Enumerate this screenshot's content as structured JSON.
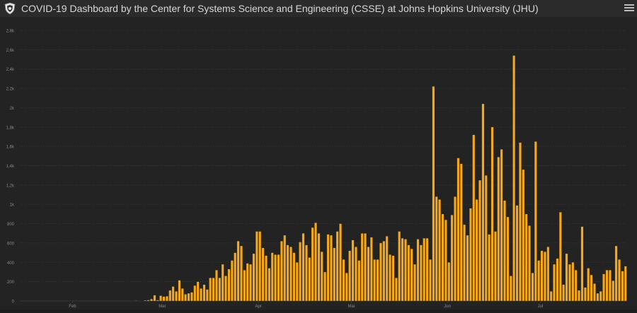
{
  "header": {
    "title": "COVID-19 Dashboard by the Center for Systems Science and Engineering (CSSE) at Johns Hopkins University (JHU)",
    "logo_icon": "shield-logo-icon",
    "menu_icon": "hamburger-menu-icon"
  },
  "colors": {
    "bar": "#f5a81c",
    "bar_stroke": "#2a2000",
    "grid": "#3a3a3a",
    "axis_text": "#8a8a8a",
    "background": "#232323"
  },
  "chart_data": {
    "type": "bar",
    "title": "",
    "xlabel": "",
    "ylabel": "",
    "ylim": [
      0,
      2800
    ],
    "yticks": [
      {
        "value": 0,
        "label": "0"
      },
      {
        "value": 200,
        "label": "200"
      },
      {
        "value": 400,
        "label": "400"
      },
      {
        "value": 600,
        "label": "600"
      },
      {
        "value": 800,
        "label": "800"
      },
      {
        "value": 1000,
        "label": "1k"
      },
      {
        "value": 1200,
        "label": "1,2k"
      },
      {
        "value": 1400,
        "label": "1,4k"
      },
      {
        "value": 1600,
        "label": "1,6k"
      },
      {
        "value": 1800,
        "label": "1,8k"
      },
      {
        "value": 2000,
        "label": "2k"
      },
      {
        "value": 2200,
        "label": "2,2k"
      },
      {
        "value": 2400,
        "label": "2,4k"
      },
      {
        "value": 2600,
        "label": "2,6k"
      },
      {
        "value": 2800,
        "label": "2,8k"
      }
    ],
    "xticks": [
      {
        "index": 17,
        "label": "Feb"
      },
      {
        "index": 46,
        "label": "Mar"
      },
      {
        "index": 77,
        "label": "Apr"
      },
      {
        "index": 107,
        "label": "Mai"
      },
      {
        "index": 138,
        "label": "Jun"
      },
      {
        "index": 168,
        "label": "Jul"
      }
    ],
    "values": [
      0,
      0,
      0,
      0,
      0,
      0,
      0,
      0,
      0,
      0,
      0,
      0,
      0,
      0,
      0,
      0,
      0,
      0,
      0,
      0,
      0,
      0,
      0,
      0,
      0,
      0,
      0,
      0,
      0,
      0,
      0,
      0,
      0,
      0,
      0,
      0,
      3,
      4,
      3,
      2,
      7,
      10,
      20,
      60,
      10,
      55,
      45,
      50,
      110,
      150,
      100,
      215,
      130,
      70,
      80,
      90,
      160,
      200,
      130,
      170,
      120,
      240,
      240,
      320,
      240,
      380,
      260,
      330,
      420,
      500,
      620,
      570,
      320,
      390,
      380,
      490,
      720,
      720,
      550,
      470,
      340,
      500,
      480,
      480,
      620,
      680,
      580,
      560,
      500,
      400,
      610,
      700,
      580,
      450,
      760,
      810,
      700,
      510,
      300,
      690,
      680,
      550,
      720,
      800,
      430,
      290,
      520,
      630,
      560,
      420,
      700,
      700,
      560,
      660,
      430,
      430,
      600,
      620,
      670,
      480,
      470,
      240,
      720,
      650,
      640,
      580,
      540,
      380,
      640,
      580,
      650,
      650,
      430,
      2220,
      1080,
      1050,
      900,
      840,
      400,
      890,
      1080,
      1480,
      1420,
      790,
      680,
      960,
      1720,
      1050,
      1250,
      2040,
      1300,
      690,
      1800,
      720,
      1490,
      1570,
      1040,
      870,
      260,
      2540,
      990,
      1640,
      1360,
      900,
      780,
      290,
      1650,
      420,
      520,
      510,
      560,
      100,
      380,
      440,
      920,
      170,
      490,
      380,
      400,
      320,
      110,
      770,
      140,
      340,
      270,
      180,
      80,
      100,
      280,
      320,
      320,
      210,
      570,
      430,
      310,
      360
    ]
  }
}
